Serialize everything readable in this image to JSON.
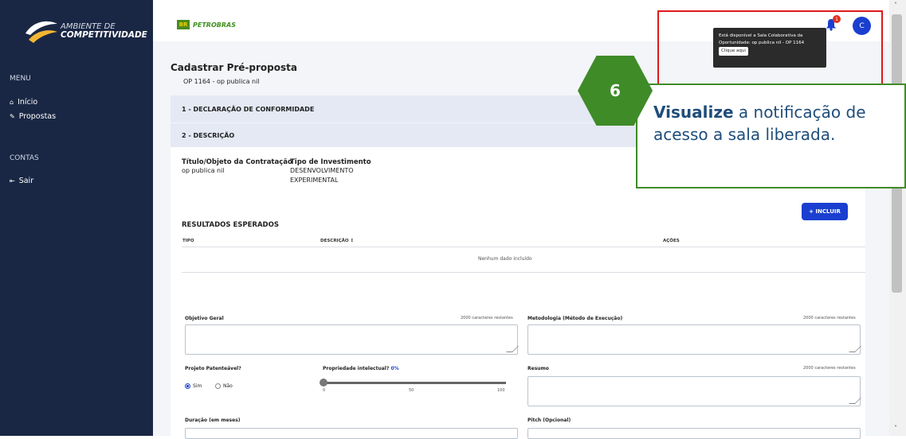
{
  "app": {
    "logo_line1": "AMBIENTE DE",
    "logo_line2": "COMPETITIVIDADE",
    "brand_box": "BR",
    "brand_name": "PETROBRAS"
  },
  "sidebar": {
    "menu_title": "MENU",
    "items": [
      {
        "label": "Início",
        "icon": "home-icon"
      },
      {
        "label": "Propostas",
        "icon": "edit-icon"
      }
    ],
    "contas_title": "CONTAS",
    "contas_items": [
      {
        "label": "Sair",
        "icon": "logout-icon"
      }
    ]
  },
  "header": {
    "notifications_count": "1",
    "avatar_initial": "C"
  },
  "tooltip": {
    "line1": "Está disponível a Sala Colaborativa da",
    "line2": "Oportunidade: op publica nil - OP 1164",
    "button": "Clique aqui"
  },
  "page": {
    "title": "Cadastrar Pré-proposta",
    "subtitle": "OP 1164 - op publica nil",
    "section1": "1 - DECLARAÇÃO DE CONFORMIDADE",
    "section2": "2 - DESCRIÇÃO"
  },
  "descricao": {
    "titulo_label": "Título/Objeto da Contratação",
    "titulo_value": "op publica nil",
    "tipo_label": "Tipo de Investimento",
    "tipo_value_line1": "DESENVOLVIMENTO",
    "tipo_value_line2": "EXPERIMENTAL"
  },
  "resultados": {
    "incluir_button": "+ INCLUIR",
    "heading": "RESULTADOS ESPERADOS",
    "columns": [
      "TIPO",
      "DESCRIÇÃO ↕",
      "AÇÕES"
    ],
    "empty": "Nenhum dado incluído"
  },
  "form": {
    "objetivo_label": "Objetivo Geral",
    "objetivo_hint": "2000 caracteres restantes",
    "metodologia_label": "Metodologia (Método de Execução)",
    "metodologia_hint": "2000 caracteres restantes",
    "patenteavel_label": "Projeto Patenteável?",
    "option_sim": "Sim",
    "option_nao": "Não",
    "selected": "Sim",
    "propriedade_label": "Propriedade intelectual?",
    "propriedade_value": "0%",
    "slider_min": "0",
    "slider_mid": "50",
    "slider_max": "100",
    "resumo_label": "Resumo",
    "resumo_hint": "2000 caracteres restantes",
    "duracao_label": "Duração (em meses)",
    "pitch_label": "Pitch (Opcional)"
  },
  "callout": {
    "step": "6",
    "bold": "Visualize",
    "text": " a notificação de acesso a sala liberada."
  },
  "colors": {
    "sidebar": "#1a2744",
    "accent": "#1a3fd0",
    "callout_green": "#3f8b28",
    "highlight_red": "#e01919"
  }
}
